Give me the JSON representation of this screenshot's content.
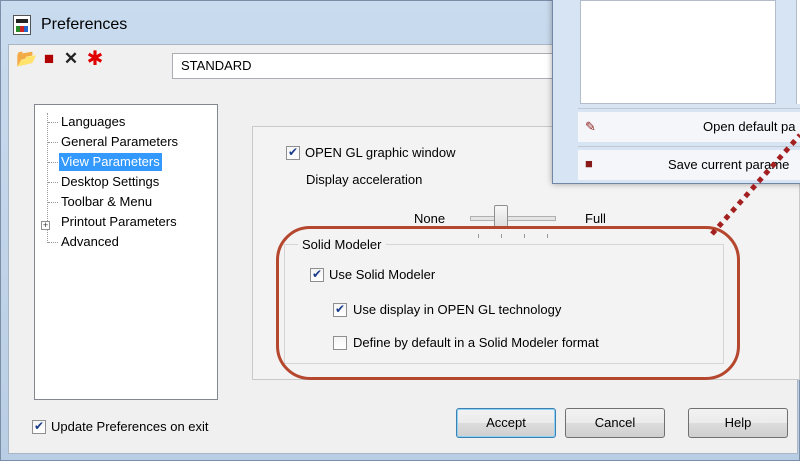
{
  "window": {
    "title": "Preferences"
  },
  "toolbar": {
    "icons": [
      "open-folder-icon",
      "save-disk-icon",
      "delete-x-icon",
      "star-red-icon"
    ],
    "combo_value": "STANDARD"
  },
  "tree": {
    "items": [
      "Languages",
      "General Parameters",
      "View Parameters",
      "Desktop Settings",
      "Toolbar & Menu",
      "Printout Parameters",
      "Advanced"
    ],
    "selected": "View Parameters"
  },
  "view": {
    "opengl_label": "OPEN GL graphic window",
    "opengl_checked": true,
    "accel_label": "Display acceleration",
    "slider_min": "None",
    "slider_max": "Full",
    "group_title": "Solid Modeler",
    "use_solid_label": "Use Solid Modeler",
    "use_solid_checked": true,
    "use_opengl_label": "Use display in OPEN GL technology",
    "use_opengl_checked": true,
    "define_default_label": "Define by default in a Solid Modeler format",
    "define_default_checked": false
  },
  "footer": {
    "update_label": "Update Preferences on exit",
    "update_checked": true,
    "accept": "Accept",
    "cancel": "Cancel",
    "help": "Help"
  },
  "overlay": {
    "open_default": "Open default pa",
    "save_current": "Save current parame"
  },
  "colors": {
    "selection": "#3399ff",
    "highlight_oval": "#b5472e"
  }
}
